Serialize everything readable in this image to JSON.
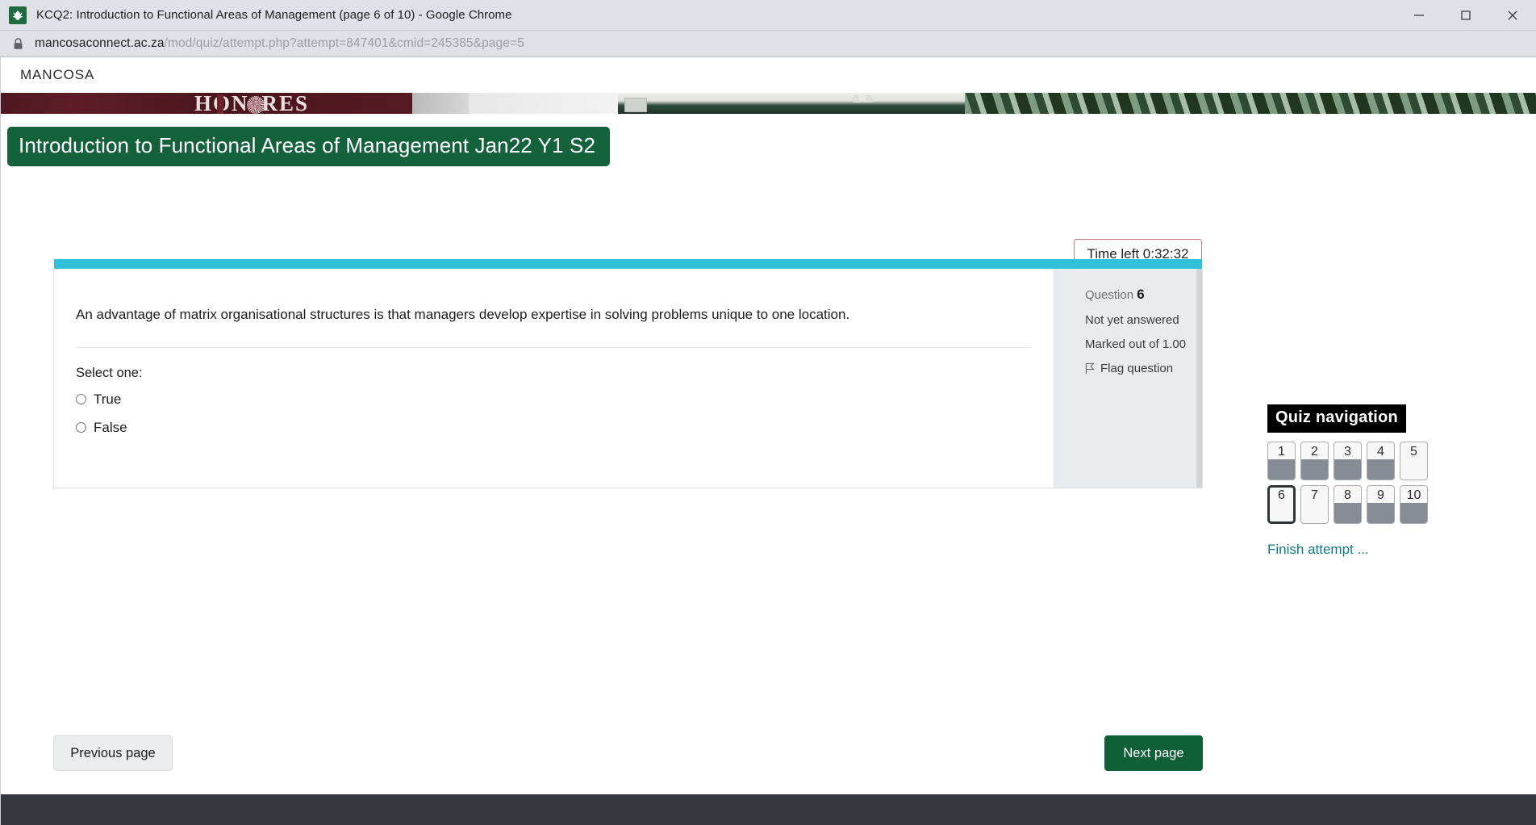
{
  "browser": {
    "window_title": "KCQ2: Introduction to Functional Areas of Management (page 6 of 10) - Google Chrome",
    "favicon_name": "mancosa-logo-icon",
    "url_host": "mancosaconnect.ac.za",
    "url_path": "/mod/quiz/attempt.php?attempt=847401&cmid=245385&page=5",
    "controls": {
      "minimize": "minimize-button",
      "maximize": "maximize-button",
      "close": "close-button"
    }
  },
  "site": {
    "brand": "MANCOSA",
    "banner_text": "HONORES"
  },
  "page": {
    "title": "Introduction to Functional Areas of Management Jan22 Y1 S2"
  },
  "timer": {
    "label": "Time left 0:32:32",
    "border_color": "#c77c7c"
  },
  "question": {
    "text": "An advantage of matrix organisational structures is that managers develop expertise in solving problems unique to one location.",
    "select_prompt": "Select one:",
    "options": [
      {
        "label": "True",
        "checked": false
      },
      {
        "label": "False",
        "checked": false
      }
    ],
    "info": {
      "question_word": "Question",
      "number": "6",
      "status": "Not yet answered",
      "marked_out_of": "Marked out of 1.00",
      "flag_label": "Flag question",
      "flag_icon": "flag-icon"
    },
    "accent_color": "#31c0d8"
  },
  "quiz_navigation": {
    "title": "Quiz navigation",
    "buttons": [
      {
        "number": "1",
        "state": "answered"
      },
      {
        "number": "2",
        "state": "answered"
      },
      {
        "number": "3",
        "state": "answered"
      },
      {
        "number": "4",
        "state": "answered"
      },
      {
        "number": "5",
        "state": "not-answered"
      },
      {
        "number": "6",
        "state": "current"
      },
      {
        "number": "7",
        "state": "not-answered"
      },
      {
        "number": "8",
        "state": "answered"
      },
      {
        "number": "9",
        "state": "answered"
      },
      {
        "number": "10",
        "state": "answered"
      }
    ],
    "finish_link": "Finish attempt ..."
  },
  "navigation": {
    "previous_label": "Previous page",
    "next_label": "Next page",
    "next_color": "#0f6037"
  }
}
